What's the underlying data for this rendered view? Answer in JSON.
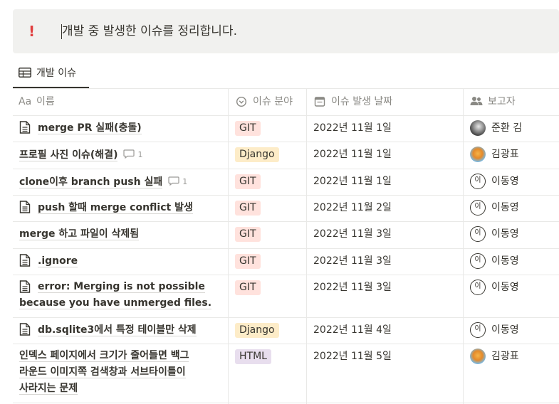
{
  "callout": {
    "icon": "!",
    "text": "개발 중 발생한 이슈를 정리합니다."
  },
  "view_tab": {
    "label": "개발 이슈",
    "icon": "table-icon"
  },
  "columns": [
    {
      "label": "이름",
      "prefix": "Aa",
      "icon": "text-type-icon"
    },
    {
      "label": "이슈 분야",
      "icon": "select-icon"
    },
    {
      "label": "이슈 발생 날짜",
      "icon": "calendar-icon"
    },
    {
      "label": "보고자",
      "icon": "people-icon"
    }
  ],
  "tag_colors": {
    "GIT": "#ffe2dd",
    "Django": "#fdecc8",
    "HTML": "#e8deee"
  },
  "rows": [
    {
      "title_lines": [
        "merge PR 실패(충돌)"
      ],
      "doc_icon": true,
      "comments": "",
      "tag": "GIT",
      "date": "2022년 11월 1일",
      "reporter": "준환 김",
      "avatar": "dark"
    },
    {
      "title_lines": [
        "프로필 사진 이슈(해결)"
      ],
      "doc_icon": false,
      "comments": "1",
      "tag": "Django",
      "date": "2022년 11월 1일",
      "reporter": "김광표",
      "avatar": "sun"
    },
    {
      "title_lines": [
        "clone이후 branch push 실패"
      ],
      "doc_icon": false,
      "comments": "1",
      "tag": "GIT",
      "date": "2022년 11월 1일",
      "reporter": "이동영",
      "avatar": "ring"
    },
    {
      "title_lines": [
        "push 할때 merge conflict 발생"
      ],
      "doc_icon": true,
      "comments": "",
      "tag": "GIT",
      "date": "2022년 11월 2일",
      "reporter": "이동영",
      "avatar": "ring"
    },
    {
      "title_lines": [
        "merge 하고 파일이 삭제됨"
      ],
      "doc_icon": false,
      "comments": "",
      "tag": "GIT",
      "date": "2022년 11월 3일",
      "reporter": "이동영",
      "avatar": "ring"
    },
    {
      "title_lines": [
        ".ignore"
      ],
      "doc_icon": true,
      "comments": "",
      "tag": "GIT",
      "date": "2022년 11월 3일",
      "reporter": "이동영",
      "avatar": "ring"
    },
    {
      "title_lines": [
        "error: Merging is not possible",
        "because you have unmerged files."
      ],
      "doc_icon": true,
      "comments": "",
      "tag": "GIT",
      "date": "2022년 11월 3일",
      "reporter": "이동영",
      "avatar": "ring"
    },
    {
      "title_lines": [
        "db.sqlite3에서 특정 테이블만 삭제"
      ],
      "doc_icon": true,
      "comments": "",
      "tag": "Django",
      "date": "2022년 11월 4일",
      "reporter": "이동영",
      "avatar": "ring"
    },
    {
      "title_lines": [
        "인덱스 페이지에서 크기가 줄어들면 백그",
        "라운드 이미지쪽 검색창과 서브타이틀이",
        "사라지는 문제"
      ],
      "doc_icon": false,
      "comments": "",
      "tag": "HTML",
      "date": "2022년 11월 5일",
      "reporter": "김광표",
      "avatar": "sun"
    }
  ],
  "ring_avatar_initial": "이"
}
